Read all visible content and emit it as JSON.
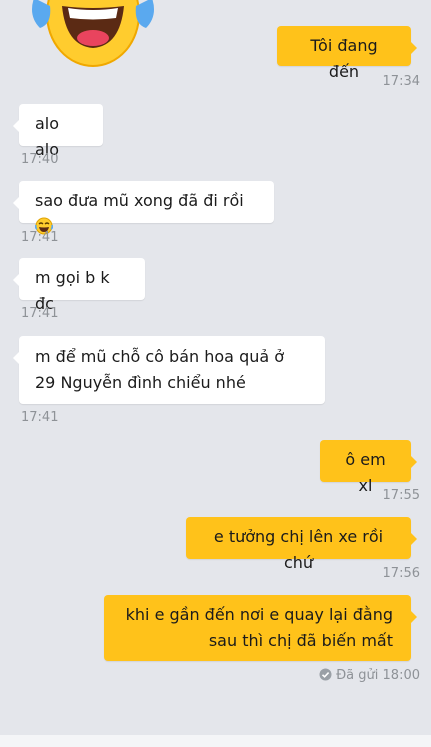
{
  "messages": [
    {
      "text": "Tôi đang đến",
      "time": "17:34"
    },
    {
      "text": "alo alo",
      "time": "17:40"
    },
    {
      "text": "sao đưa mũ xong đã đi rồi",
      "time": "17:41"
    },
    {
      "text": "m gọi b k đc",
      "time": "17:41"
    },
    {
      "text": "m để mũ chỗ cô bán hoa quả ở 29 Nguyễn đình chiểu nhé",
      "time": "17:41"
    },
    {
      "text": "ô em xl",
      "time": "17:55"
    },
    {
      "text": "e tưởng chị lên xe rồi chứ",
      "time": "17:56"
    },
    {
      "text": "khi e gần đến nơi e quay lại đằng sau thì chị đã biến mất",
      "time": "18:00"
    }
  ],
  "status": {
    "sent_label": "Đã gửi"
  },
  "icons": {
    "top_emoji": "tears-of-joy-emoji-icon",
    "inline_emoji": "laughing-emoji-icon",
    "sent_status": "checkmark-circle-icon"
  },
  "colors": {
    "background": "#e4e6eb",
    "incoming_bubble": "#ffffff",
    "outgoing_bubble": "#ffc21a",
    "timestamp": "#8e9297"
  }
}
